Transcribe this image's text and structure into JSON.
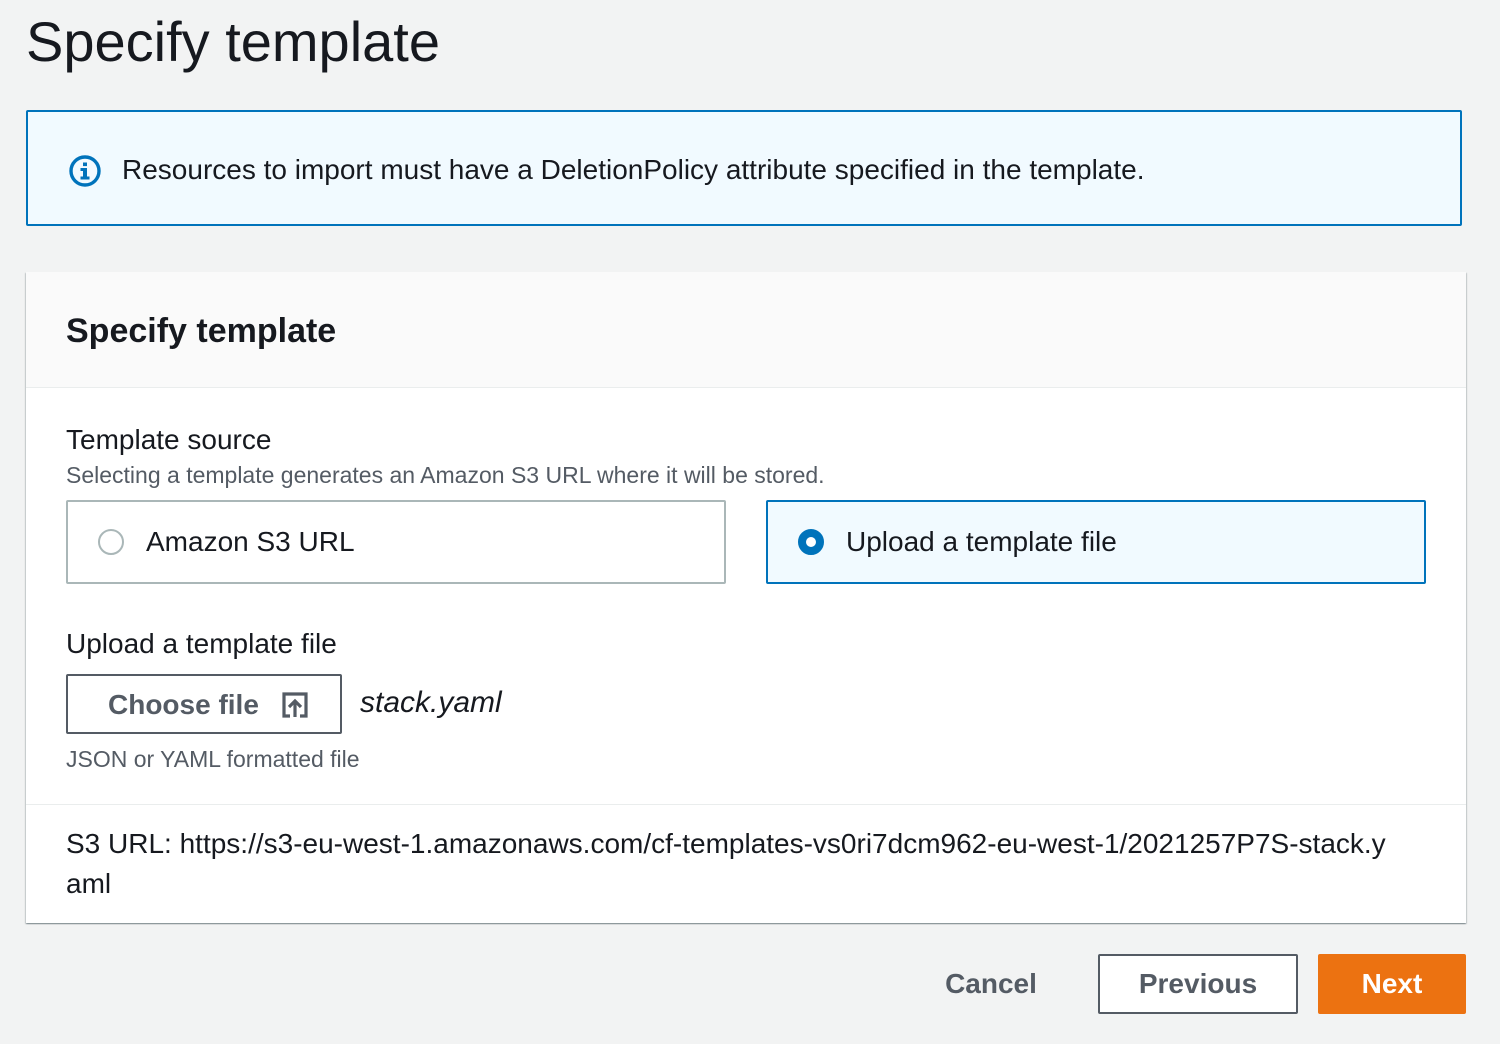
{
  "page": {
    "title": "Specify template"
  },
  "alert": {
    "icon": "info-icon",
    "message": "Resources to import must have a DeletionPolicy attribute specified in the template."
  },
  "panel": {
    "header": "Specify template",
    "template_source": {
      "label": "Template source",
      "description": "Selecting a template generates an Amazon S3 URL where it will be stored.",
      "options": [
        {
          "label": "Amazon S3 URL",
          "selected": false
        },
        {
          "label": "Upload a template file",
          "selected": true
        }
      ]
    },
    "upload": {
      "label": "Upload a template file",
      "button_label": "Choose file",
      "button_icon": "upload-icon",
      "filename": "stack.yaml",
      "constraint": "JSON or YAML formatted file"
    },
    "s3_url": "S3 URL: https://s3-eu-west-1.amazonaws.com/cf-templates-vs0ri7dcm962-eu-west-1/2021257P7S-stack.yaml"
  },
  "actions": {
    "cancel": "Cancel",
    "previous": "Previous",
    "next": "Next"
  },
  "colors": {
    "primary_button": "#ec7211",
    "selected_border": "#0073bb",
    "info_background": "#f1faff",
    "page_background": "#f2f3f3"
  }
}
